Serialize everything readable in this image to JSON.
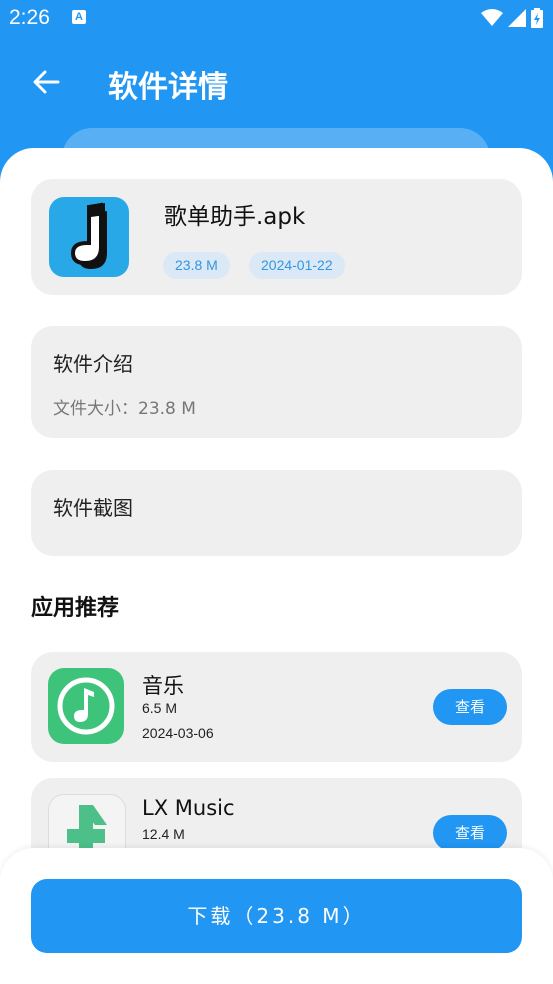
{
  "status_bar": {
    "time": "2:26",
    "notification_icon": "A"
  },
  "appbar": {
    "title": "软件详情",
    "back_icon": "arrow-left-icon"
  },
  "app": {
    "name": "歌单助手.apk",
    "size": "23.8 M",
    "date": "2024-01-22",
    "icon": "music-note-icon",
    "icon_color": "#29a8e8"
  },
  "intro": {
    "title": "软件介绍",
    "text": "文件大小：23.8 M"
  },
  "screenshots": {
    "title": "软件截图"
  },
  "recommend": {
    "heading": "应用推荐",
    "items": [
      {
        "name": "音乐",
        "size": "6.5 M",
        "date": "2024-03-06",
        "button": "查看",
        "icon": "music-note-icon",
        "icon_color": "#3ec47a"
      },
      {
        "name": "LX Music",
        "size": "12.4 M",
        "date": "",
        "button": "查看",
        "icon": "lx-music-icon",
        "icon_color": "#4dc08a"
      }
    ]
  },
  "download": {
    "label": "下载（23.8 M）"
  },
  "colors": {
    "primary": "#2196F3",
    "card": "#efefef",
    "badge_bg": "#dbe8f5",
    "badge_text": "#3296e3"
  }
}
